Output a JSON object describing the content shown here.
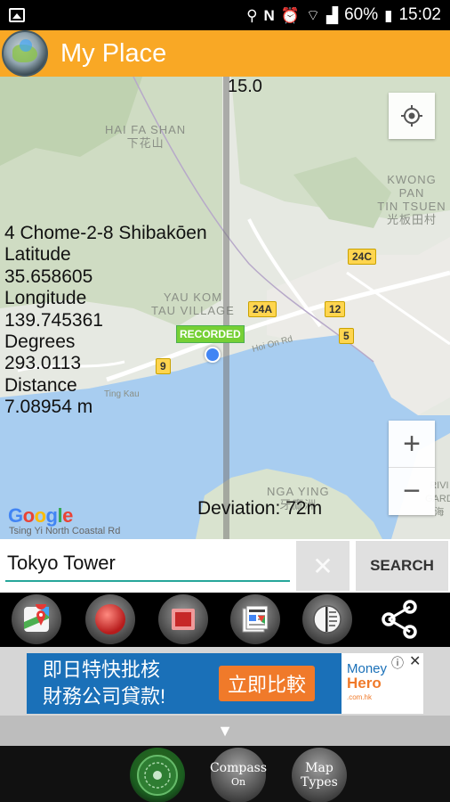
{
  "status_bar": {
    "battery": "60%",
    "time": "15:02",
    "icons": [
      "image-icon",
      "location-icon",
      "nfc-icon",
      "alarm-icon",
      "wifi-icon",
      "signal-icon",
      "battery-icon"
    ]
  },
  "app_bar": {
    "title": "My Place",
    "logo": "globe-logo"
  },
  "map": {
    "top_value": "15.0",
    "info": {
      "address": "4 Chome-2-8 Shibakōen",
      "latitude_label": "Latitude",
      "latitude": "35.658605",
      "longitude_label": "Longitude",
      "longitude": "139.745361",
      "degrees_label": "Degrees",
      "degrees": "293.0113",
      "distance_label": "Distance",
      "distance": "7.08954 m"
    },
    "recorded_label": "RECORDED",
    "deviation": "Deviation: 72m",
    "attribution": "Google",
    "zoom_in": "+",
    "zoom_out": "−",
    "place_labels": {
      "hai_fa_shan": "HAI FA SHAN",
      "hai_fa_shan_cn": "下花山",
      "kwong_pan": "KWONG PAN",
      "tin_tsuen": "TIN TSUEN",
      "tin_tsuen_cn": "光板田村",
      "yau_kom": "YAU KOM",
      "tau_village": "TAU VILLAGE",
      "nga_ying": "NGA YING",
      "nga_ying_cn": "牙鷹洲",
      "ting_kau": "Ting Kau",
      "hoi_on": "Hoi On Rd",
      "tsing_yi": "Tsing Yi North Coastal Rd",
      "rivi": "RIVI",
      "gard": "GARD",
      "hai_cn": "海"
    },
    "road_badges": [
      "24C",
      "24A",
      "12",
      "5",
      "9"
    ]
  },
  "search": {
    "value": "Tokyo Tower",
    "clear_symbol": "✕",
    "button_label": "SEARCH"
  },
  "toolbar": {
    "buttons": [
      "maps-icon",
      "record-icon",
      "stop-icon",
      "news-icon",
      "compass-toggle-icon",
      "share-icon"
    ]
  },
  "ad": {
    "line1": "即日特快批核",
    "line2": "財務公司貸款!",
    "cta": "立即比較",
    "brand_line1": "Money",
    "brand_line2": "Hero",
    "brand_suffix": ".com.hk",
    "info_symbol": "ⓘ",
    "close_symbol": "✕"
  },
  "collapse_symbol": "▼",
  "bottom_bar": {
    "compass_title": "Compass",
    "compass_state": "On",
    "map_types_line1": "Map",
    "map_types_line2": "Types"
  }
}
